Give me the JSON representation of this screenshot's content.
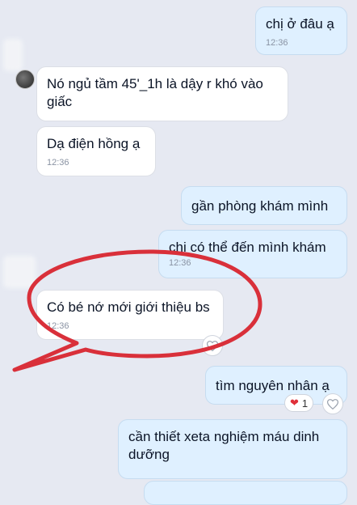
{
  "messages": [
    {
      "id": "m1",
      "text": "chị ở đâu ạ",
      "time": "12:36"
    },
    {
      "id": "m2",
      "text": "Nó ngủ tầm 45'_1h là dậy r khó vào giấc",
      "time": ""
    },
    {
      "id": "m3",
      "text": "Dạ điện hồng ạ",
      "time": "12:36"
    },
    {
      "id": "m4",
      "text": "gần phòng khám mình",
      "time": ""
    },
    {
      "id": "m5",
      "text": "chị có thể đến mình khám",
      "time": "12:36"
    },
    {
      "id": "m6",
      "text": "Có bé nớ mới giới thiệu bs",
      "time": "12:36"
    },
    {
      "id": "m7",
      "text": "tìm nguyên nhân ạ",
      "time": ""
    },
    {
      "id": "m8",
      "text": "cần thiết xeta nghiệm máu dinh dưỡng",
      "time": ""
    }
  ],
  "reactions": {
    "heart_count": "1"
  },
  "colors": {
    "annotation": "#d9303a",
    "incoming": "#ffffff",
    "outgoing": "#dff0ff"
  }
}
